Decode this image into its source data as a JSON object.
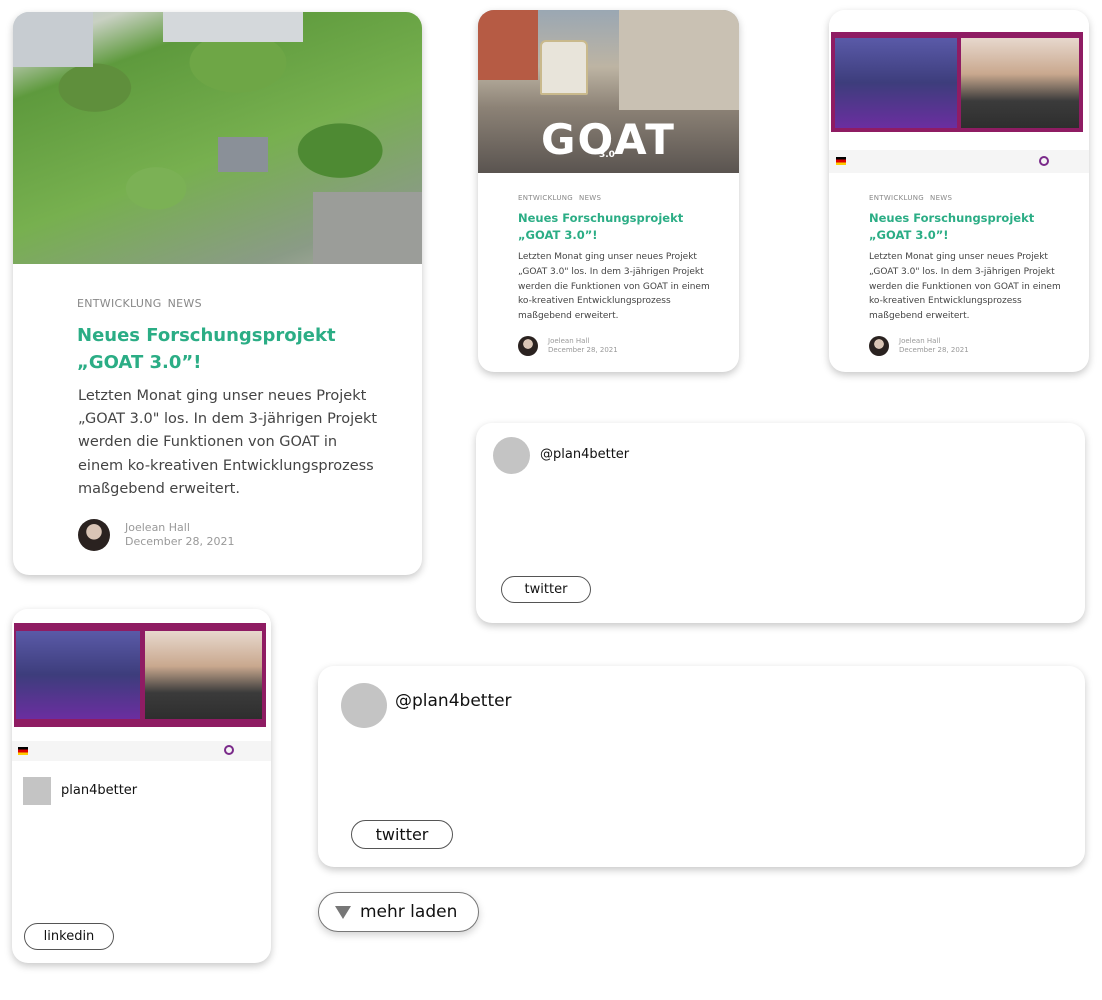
{
  "posts": [
    {
      "tags": [
        "ENTWICKLUNG",
        "NEWS"
      ],
      "title_line1": "Neues Forschungsprojekt",
      "title_line2": "„GOAT 3.0”!",
      "excerpt": "Letzten Monat ging unser neues Projekt „GOAT 3.0\" los. In dem 3-jährigen Projekt werden die Funktionen von GOAT in einem ko-kreativen Entwicklungsprozess maßgebend erweitert.",
      "author": "Joelean Hall",
      "date": "December 28, 2021",
      "image": "park-aerial"
    },
    {
      "tags": [
        "ENTWICKLUNG",
        "NEWS"
      ],
      "title_line1": "Neues Forschungsprojekt",
      "title_line2": "„GOAT 3.0”!",
      "excerpt": "Letzten Monat ging unser neues Projekt „GOAT 3.0\" los. In dem 3-jährigen Projekt werden die Funktionen von GOAT in einem ko-kreativen Entwicklungsprozess maßgebend erweitert.",
      "author": "Joelean Hall",
      "date": "December 28, 2021",
      "image": "street-goat-logo",
      "logo_text": "GOAT",
      "logo_sub": "3.0"
    },
    {
      "tags": [
        "ENTWICKLUNG",
        "NEWS"
      ],
      "title_line1": "Neues Forschungsprojekt",
      "title_line2": "„GOAT 3.0”!",
      "excerpt": "Letzten Monat ging unser neues Projekt „GOAT 3.0\" los. In dem 3-jährigen Projekt werden die Funktionen von GOAT in einem ko-kreativen Entwicklungsprozess maßgebend erweitert.",
      "author": "Joelean Hall",
      "date": "December 28, 2021",
      "image": "award-video-call"
    }
  ],
  "social": [
    {
      "handle": "@plan4better",
      "network": "twitter"
    },
    {
      "handle": "plan4better",
      "network": "linkedin",
      "image": "award-video-call"
    },
    {
      "handle": "@plan4better",
      "network": "twitter"
    }
  ],
  "load_more": {
    "label": "mehr laden",
    "icon": "triangle-down-icon"
  },
  "colors": {
    "accent": "#2bad85",
    "award_frame": "#8f1c63",
    "placeholder": "#c4c4c4"
  }
}
